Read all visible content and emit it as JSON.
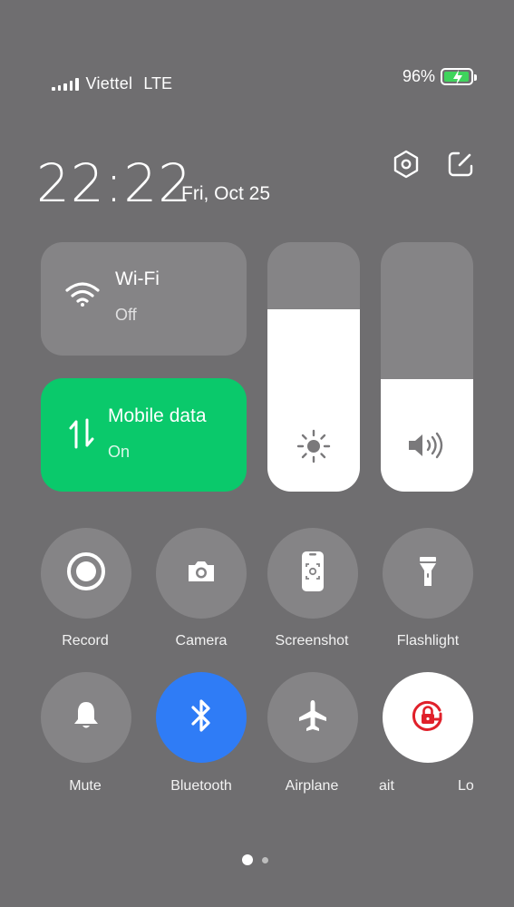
{
  "status_bar": {
    "carrier": "Viettel",
    "network_type": "LTE",
    "battery_percent": "96%",
    "signal_bars": 5
  },
  "header": {
    "time": "22:22",
    "date": "Fri, Oct 25",
    "settings_icon": "settings-hexagon-icon",
    "edit_icon": "edit-icon"
  },
  "tiles": {
    "wifi": {
      "title": "Wi-Fi",
      "status": "Off",
      "icon": "wifi-icon"
    },
    "mobile_data": {
      "title": "Mobile data",
      "status": "On",
      "icon": "data-arrows-icon",
      "color": "#0ac96b"
    }
  },
  "sliders": {
    "brightness": {
      "level": 0.73,
      "icon": "sun-icon"
    },
    "volume": {
      "level": 0.45,
      "icon": "speaker-icon"
    }
  },
  "toggles_row1": [
    {
      "label": "Record",
      "icon": "record-icon"
    },
    {
      "label": "Camera",
      "icon": "camera-icon"
    },
    {
      "label": "Screenshot",
      "icon": "screenshot-icon"
    },
    {
      "label": "Flashlight",
      "icon": "flashlight-icon"
    }
  ],
  "toggles_row2": [
    {
      "label": "Mute",
      "icon": "bell-icon"
    },
    {
      "label": "Bluetooth",
      "icon": "bluetooth-icon",
      "active_color": "#2f7cf6"
    },
    {
      "label": "Airplane",
      "icon": "airplane-icon"
    },
    {
      "label": "ait",
      "icon": "rotation-lock-icon",
      "active_color": "#ffffff"
    },
    {
      "label": "Lo"
    }
  ],
  "pager": {
    "pages": 2,
    "current": 1
  }
}
